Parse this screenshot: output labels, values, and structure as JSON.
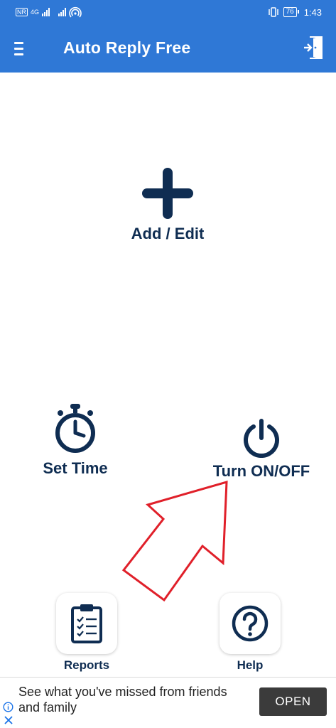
{
  "status_bar": {
    "carrier_badge": "NR",
    "network_type": "4G",
    "battery_level": "76",
    "time": "1:43",
    "icons": [
      "volte-icon",
      "signal-icon",
      "signal-icon",
      "hotspot-icon",
      "vibrate-icon",
      "battery-icon"
    ]
  },
  "app_bar": {
    "title": "Auto Reply Free",
    "menu_icon": "hamburger-menu-icon",
    "exit_icon": "exit-door-icon",
    "background_color": "#2f78d6"
  },
  "actions": {
    "add_edit": {
      "label": "Add / Edit",
      "icon": "plus-icon"
    },
    "set_time": {
      "label": "Set Time",
      "icon": "stopwatch-icon"
    },
    "turn_onoff": {
      "label": "Turn ON/OFF",
      "icon": "power-icon"
    }
  },
  "tiles": {
    "reports": {
      "label": "Reports",
      "icon": "clipboard-icon"
    },
    "help": {
      "label": "Help",
      "icon": "question-icon"
    }
  },
  "annotation": {
    "icon": "red-arrow-icon",
    "color": "#e0202a"
  },
  "ad": {
    "text": "See what you've missed from friends and family",
    "button_label": "OPEN",
    "info_icon": "info-icon",
    "close_icon": "close-icon",
    "accent_color": "#1a73e8"
  },
  "colors": {
    "primary_dark": "#0f2d52",
    "app_bar": "#2f78d6"
  }
}
